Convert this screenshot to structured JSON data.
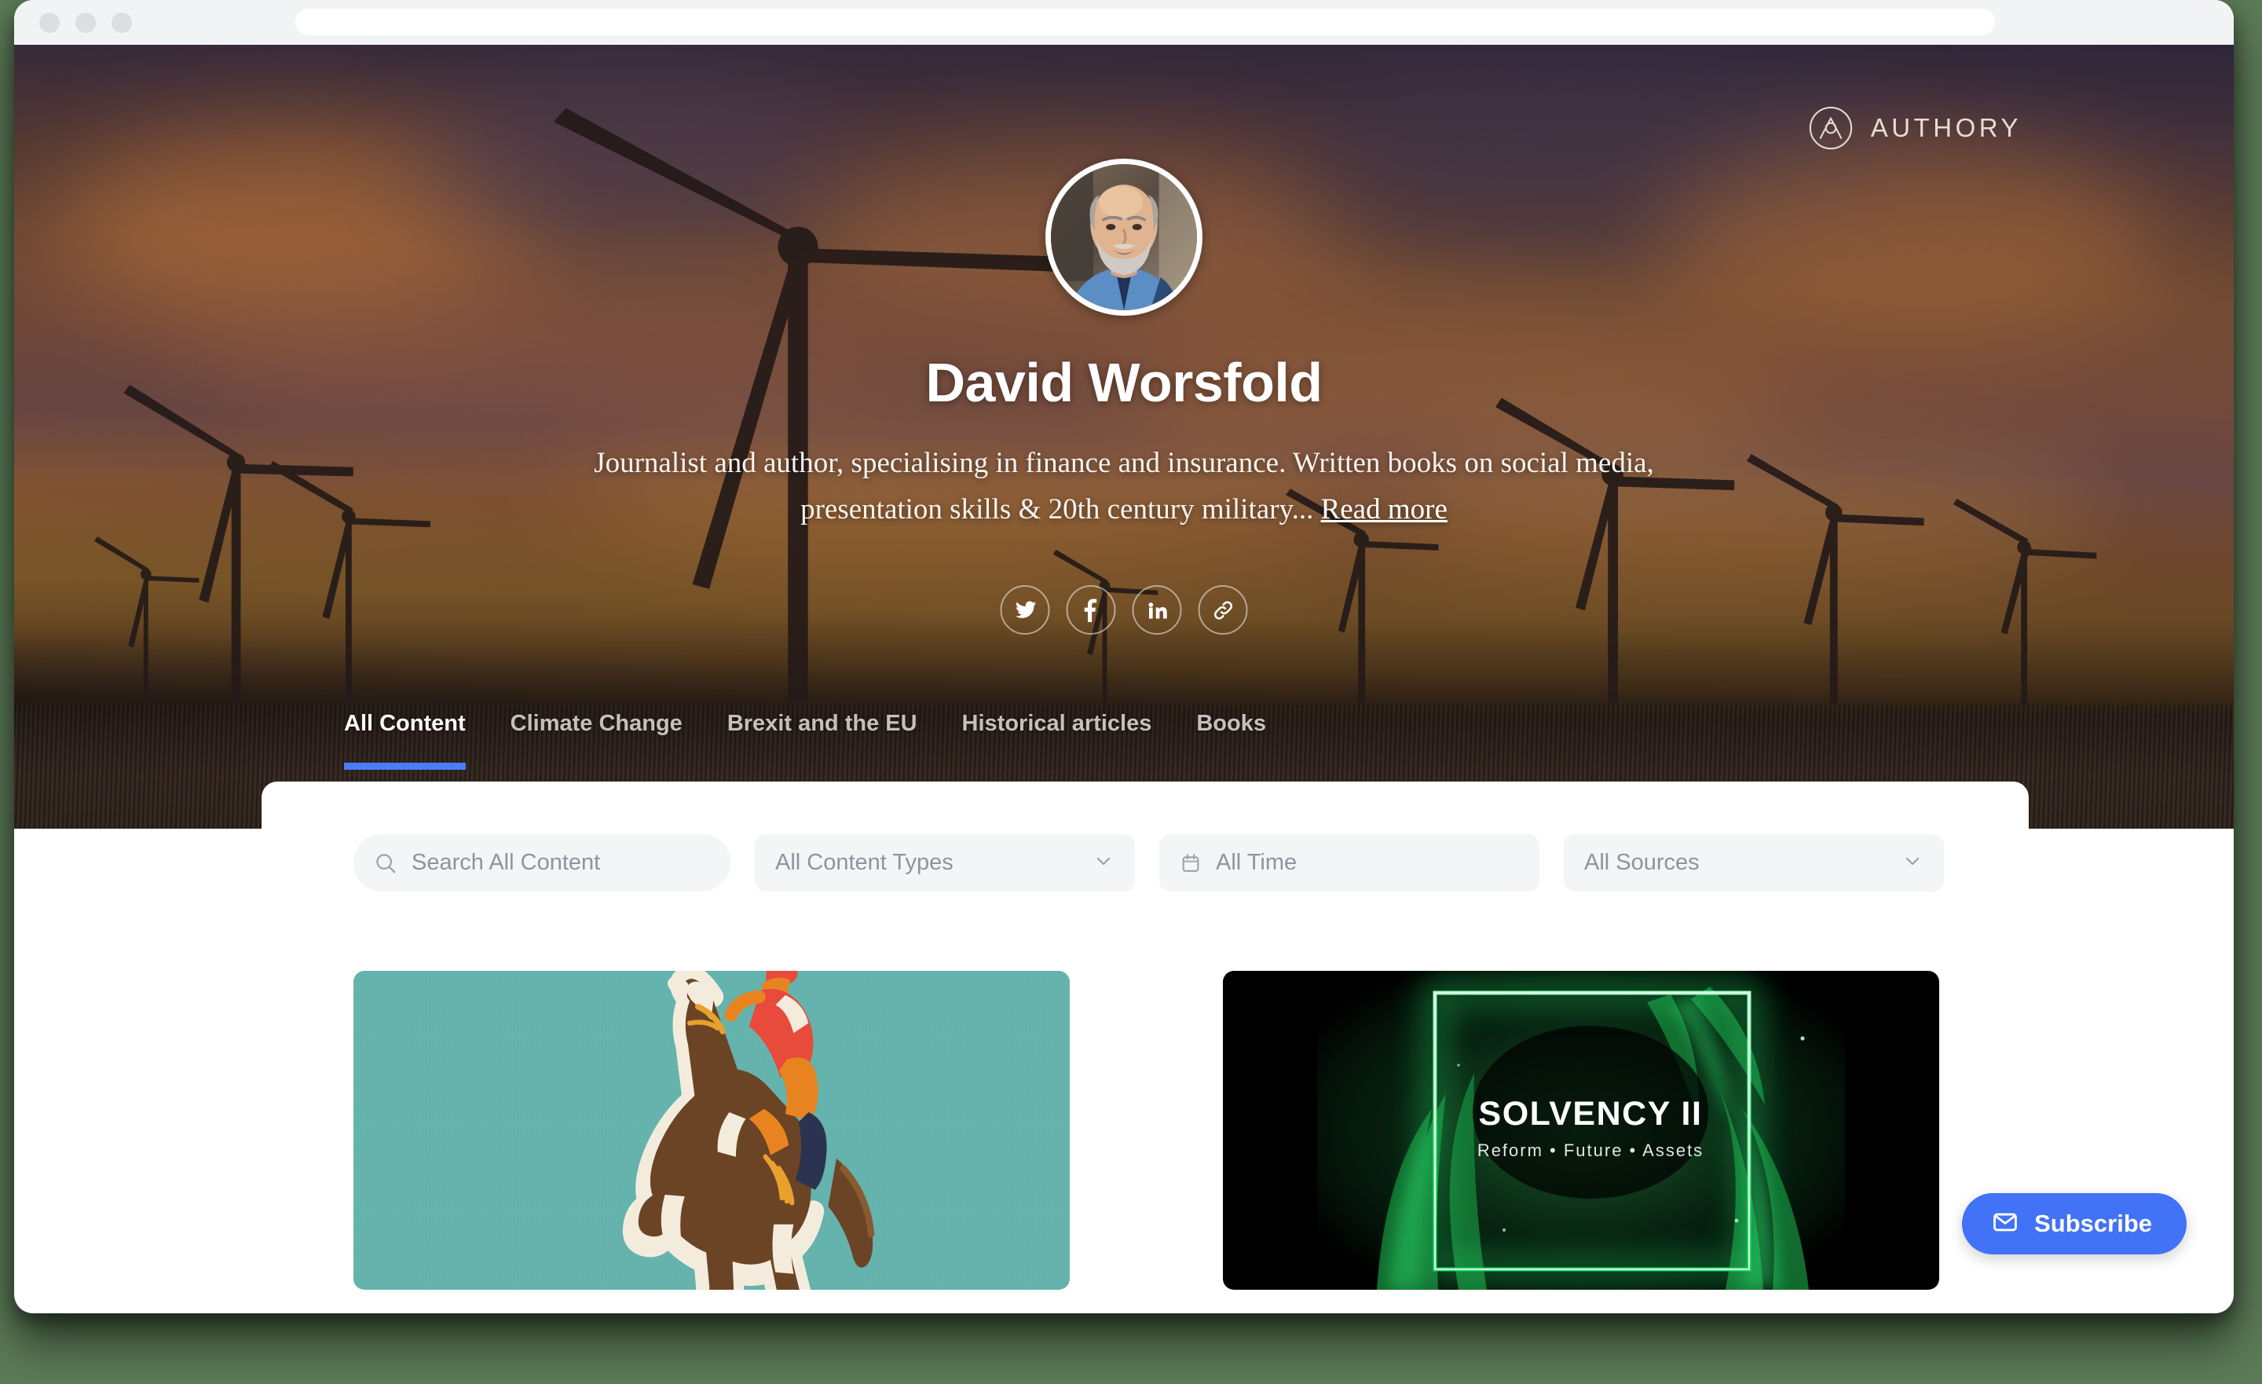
{
  "browser": {
    "address_bar_value": "",
    "traffic_lights": [
      "close",
      "minimize",
      "maximize"
    ]
  },
  "brand": {
    "name": "AUTHORY",
    "logo_icon": "authory-circle-a-icon"
  },
  "profile": {
    "name": "David Worsfold",
    "bio": "Journalist and author, specialising in finance and insurance. Written books on social media, presentation skills & 20th century military...",
    "read_more_label": "Read more",
    "avatar_alt": "David Worsfold profile photo"
  },
  "social_links": [
    {
      "name": "twitter",
      "icon": "twitter-icon"
    },
    {
      "name": "facebook",
      "icon": "facebook-icon"
    },
    {
      "name": "linkedin",
      "icon": "linkedin-icon"
    },
    {
      "name": "website",
      "icon": "link-icon"
    }
  ],
  "nav": {
    "tabs": [
      {
        "label": "All Content",
        "active": true
      },
      {
        "label": "Climate Change",
        "active": false
      },
      {
        "label": "Brexit and the EU",
        "active": false
      },
      {
        "label": "Historical articles",
        "active": false
      },
      {
        "label": "Books",
        "active": false
      }
    ],
    "active_indicator_color": "#4a7cf7"
  },
  "filters": {
    "search": {
      "placeholder": "Search All Content",
      "value": "",
      "icon": "search-icon"
    },
    "content_types": {
      "value": "All Content Types",
      "icon": "chevron-down-icon"
    },
    "time": {
      "value": "All Time",
      "icon": "calendar-icon"
    },
    "sources": {
      "value": "All Sources",
      "icon": "chevron-down-icon"
    }
  },
  "cards": [
    {
      "id": "card-horse-jockey",
      "alt": "Illustration of a rearing brown horse with a jockey in red and orange silks on a teal background",
      "background_color": "#63b3ac"
    },
    {
      "id": "card-solvency-ii",
      "alt": "Dark green neon graphic reading SOLVENCY II",
      "title": "SOLVENCY II",
      "subtitle": "Reform • Future • Assets",
      "background_color": "#041206"
    }
  ],
  "subscribe": {
    "label": "Subscribe",
    "icon": "envelope-icon",
    "color": "#4272f5"
  },
  "theme": {
    "page_background": "#5c7b57",
    "panel_background": "#ffffff",
    "accent_blue": "#4272f5",
    "filter_field_background": "#f4f5f7",
    "muted_text": "#8e949e"
  }
}
